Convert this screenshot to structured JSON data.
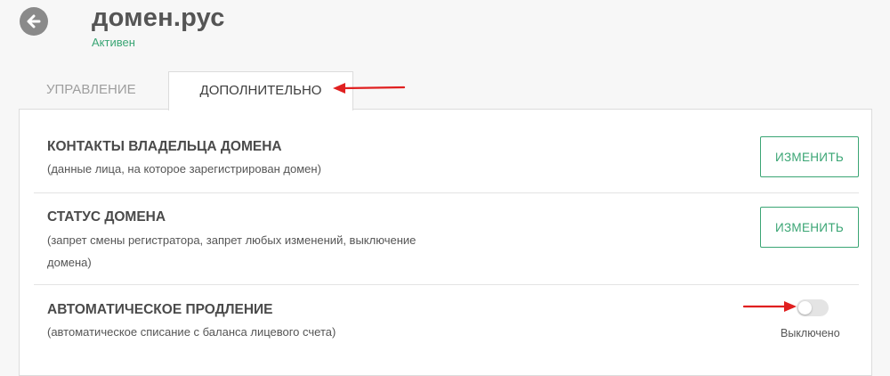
{
  "header": {
    "back_icon": "arrow-left-icon",
    "title": "домен.рус",
    "status": "Активен"
  },
  "tabs": [
    {
      "label": "УПРАВЛЕНИЕ",
      "active": false
    },
    {
      "label": "ДОПОЛНИТЕЛЬНО",
      "active": true
    }
  ],
  "sections": [
    {
      "title": "КОНТАКТЫ ВЛАДЕЛЬЦА ДОМЕНА",
      "description_lines": [
        "(данные лица, на которое зарегистрирован домен)"
      ],
      "button_label": "ИЗМЕНИТЬ"
    },
    {
      "title": "СТАТУС ДОМЕНА",
      "description_lines": [
        "(запрет смены регистратора, запрет любых изменений, выключение",
        "домена)"
      ],
      "button_label": "ИЗМЕНИТЬ"
    },
    {
      "title": "АВТОМАТИЧЕСКОЕ ПРОДЛЕНИЕ",
      "description_lines": [
        "(автоматическое списание с баланса лицевого счета)"
      ],
      "toggle_on": false,
      "toggle_label": "Выключено"
    }
  ],
  "colors": {
    "accent": "#3aa574",
    "annotation_arrow": "#e02020",
    "background": "#f7f7f7"
  }
}
